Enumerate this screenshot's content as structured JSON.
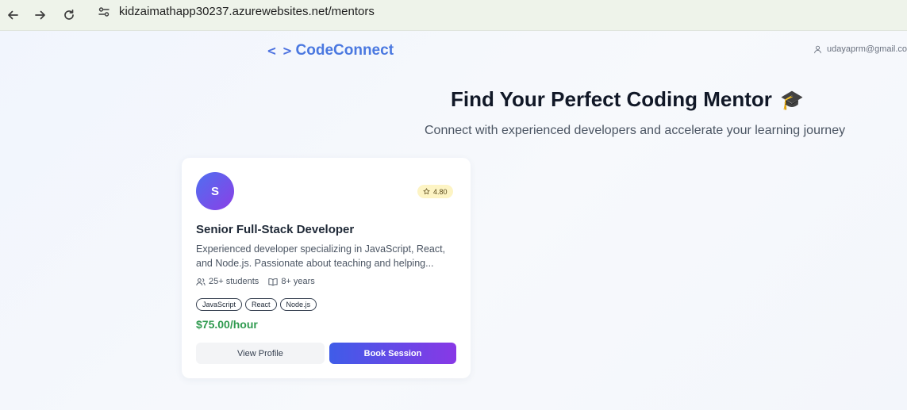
{
  "browser": {
    "url": "kidzaimathapp30237.azurewebsites.net/mentors"
  },
  "header": {
    "logo_icon": "< >",
    "logo_text": "CodeConnect",
    "user_email": "udayaprm@gmail.co"
  },
  "hero": {
    "title": "Find Your Perfect Coding Mentor",
    "title_emoji": "🎓",
    "subtitle": "Connect with experienced developers and accelerate your learning journey"
  },
  "mentor_card": {
    "avatar_initial": "S",
    "rating": "4.80",
    "title": "Senior Full-Stack Developer",
    "description": "Experienced developer specializing in JavaScript, React, and Node.js. Passionate about teaching and helping...",
    "students": "25+ students",
    "experience": "8+ years",
    "tags": [
      "JavaScript",
      "React",
      "Node.js"
    ],
    "price": "$75.00/hour",
    "view_profile_label": "View Profile",
    "book_session_label": "Book Session"
  },
  "colors": {
    "brand": "#4a78e0",
    "price_green": "#2f9a4f",
    "button_gradient_start": "#3f5ce8",
    "button_gradient_end": "#8838e6",
    "rating_bg": "#fdf4c4"
  }
}
